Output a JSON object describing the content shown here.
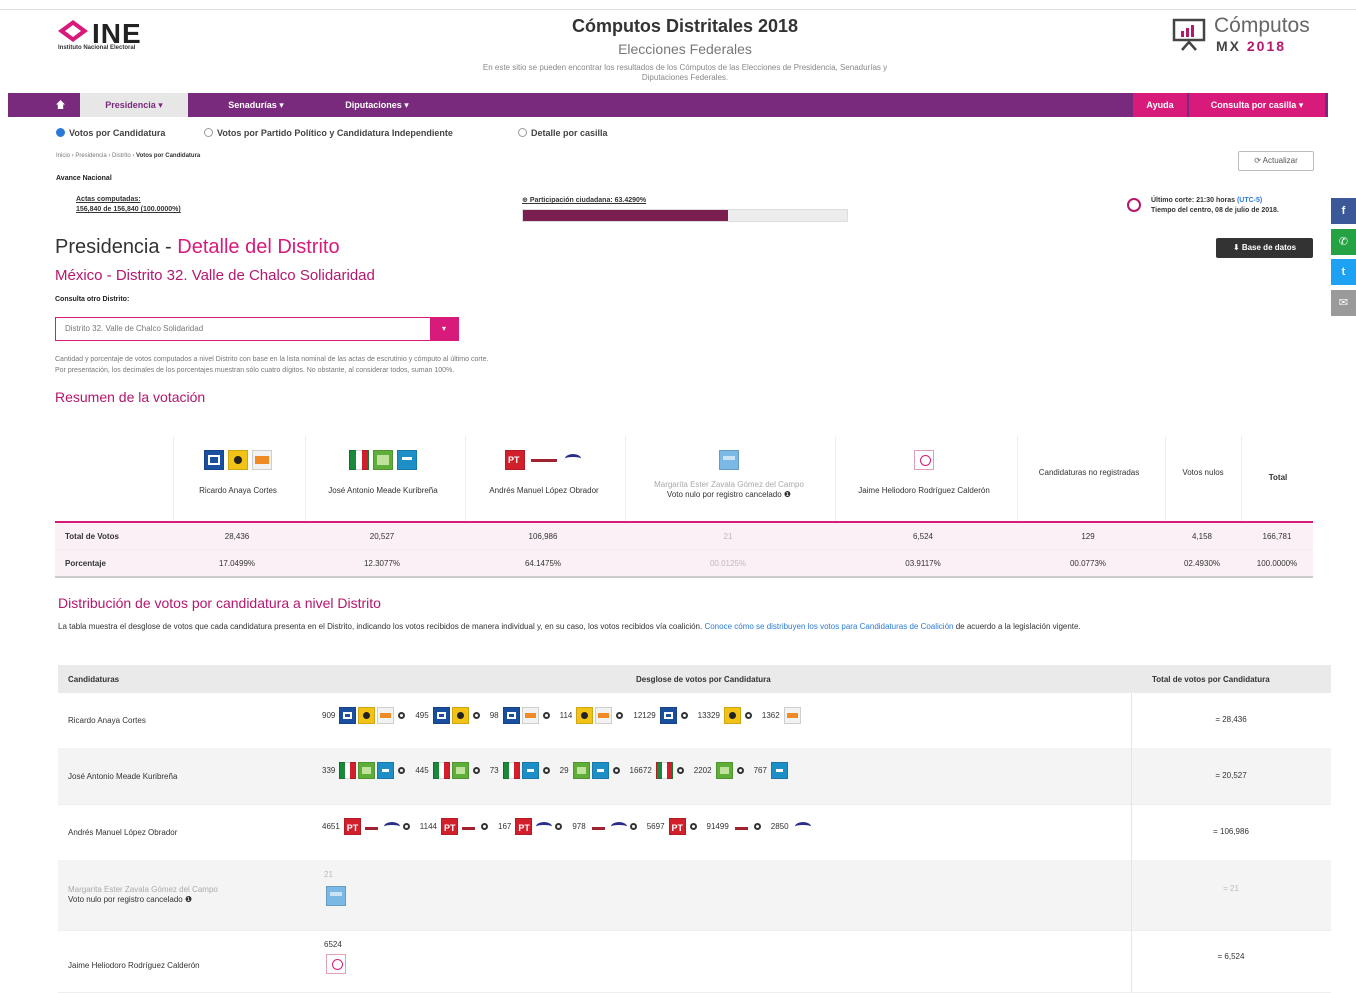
{
  "header": {
    "logo_text": "INE",
    "logo_sub": "Instituto Nacional Electoral",
    "title": "Cómputos Distritales 2018",
    "subtitle": "Elecciones Federales",
    "description_1": "En este sitio se pueden encontrar los resultados de los Cómputos de las Elecciones de Presidencia, Senadurías y",
    "description_2": "Diputaciones Federales.",
    "brand_top": "Cómputos",
    "brand_mx": "MX",
    "brand_year": "2018"
  },
  "nav": {
    "home_icon": "home-icon",
    "presidencia": "Presidencia ▾",
    "senadurias": "Senadurías ▾",
    "diputaciones": "Diputaciones ▾",
    "ayuda": "Ayuda",
    "consulta": "Consulta por casilla ▾"
  },
  "views": {
    "opt1": "Votos por Candidatura",
    "opt2": "Votos por Partido Político y Candidatura Independiente",
    "opt3": "Detalle por casilla"
  },
  "breadcrumb": {
    "path": "Inicio › Presidencia › Distrito › ",
    "current": "Votos por Candidatura"
  },
  "actualizar": "⟳ Actualizar",
  "avance": {
    "label": "Avance Nacional",
    "actas_label": "Actas computadas:",
    "actas_value": "156,840 de 156,840 (100.0000%)",
    "participacion": "Participación ciudadana: 63.4290%",
    "participacion_fraction": 0.634,
    "corte_1": "Último corte: 21:30 horas ",
    "corte_utc": "(UTC-5)",
    "corte_2": "Tiempo del centro, 08 de julio de 2018."
  },
  "social": {
    "fb": "f",
    "wa": "✆",
    "tw": "t",
    "em": "✉"
  },
  "page": {
    "title_a": "Presidencia - ",
    "title_b": "Detalle del Distrito",
    "base_datos": "⬇ Base de datos",
    "distrito": "México - Distrito 32. Valle de Chalco Solidaridad",
    "consulta_label": "Consulta otro Distrito:",
    "select_value": "Distrito 32. Valle de Chalco Solidaridad",
    "note_1": "Cantidad y porcentaje de votos computados a nivel Distrito con base en la lista nominal de las actas de escrutinio y cómputo al último corte.",
    "note_2": "Por presentación, los decimales de los porcentajes muestran sólo cuatro dígitos. No obstante, al considerar todos, suman 100%.",
    "resumen": "Resumen de la votación"
  },
  "summary": {
    "row_total_label": "Total de Votos",
    "row_pct_label": "Porcentaje",
    "columns": [
      {
        "name": "Ricardo Anaya Cortes",
        "total": "28,436",
        "pct": "17.0499%"
      },
      {
        "name": "José Antonio Meade Kuribreña",
        "total": "20,527",
        "pct": "12.3077%"
      },
      {
        "name": "Andrés Manuel López Obrador",
        "total": "106,986",
        "pct": "64.1475%"
      },
      {
        "name": "Margarita Ester Zavala Gómez del Campo",
        "nulo": "Voto nulo por registro cancelado ❶",
        "total": "21",
        "pct": "00.0125%"
      },
      {
        "name": "Jaime Heliodoro Rodríguez Calderón",
        "total": "6,524",
        "pct": "03.9117%"
      },
      {
        "name": "Candidaturas no registradas",
        "total": "129",
        "pct": "00.0773%"
      },
      {
        "name": "Votos nulos",
        "total": "4,158",
        "pct": "02.4930%"
      },
      {
        "name": "Total",
        "total": "166,781",
        "pct": "100.0000%"
      }
    ]
  },
  "distribution": {
    "title": "Distribución de votos por candidatura a nivel Distrito",
    "desc": "La tabla muestra el desglose de votos que cada candidatura presenta en el Distrito, indicando los votos recibidos de manera individual y, en su caso, los votos recibidos vía coalición. ",
    "desc_link": "Conoce cómo se distribuyen los votos para Candidaturas de Coalición",
    "desc_end": " de acuerdo a la legislación vigente.",
    "head_cand": "Candidaturas",
    "head_desglose": "Desglose de votos por Candidatura",
    "head_total": "Total de votos por Candidatura",
    "rows": [
      {
        "cand": "Ricardo Anaya Cortes",
        "total": "= 28,436",
        "groups": [
          {
            "n": "909",
            "p": [
              "pan",
              "prd",
              "mc"
            ]
          },
          {
            "n": "495",
            "p": [
              "pan",
              "prd"
            ]
          },
          {
            "n": "98",
            "p": [
              "pan",
              "mc"
            ]
          },
          {
            "n": "114",
            "p": [
              "prd",
              "mc"
            ]
          },
          {
            "n": "12129",
            "p": [
              "pan"
            ]
          },
          {
            "n": "13329",
            "p": [
              "prd"
            ]
          },
          {
            "n": "1362",
            "p": [
              "mc"
            ],
            "last": true
          }
        ]
      },
      {
        "cand": "José Antonio Meade Kuribreña",
        "total": "= 20,527",
        "groups": [
          {
            "n": "339",
            "p": [
              "pri",
              "pvem",
              "na"
            ]
          },
          {
            "n": "445",
            "p": [
              "pri",
              "pvem"
            ]
          },
          {
            "n": "73",
            "p": [
              "pri",
              "na"
            ]
          },
          {
            "n": "29",
            "p": [
              "pvem",
              "na"
            ]
          },
          {
            "n": "16672",
            "p": [
              "pri"
            ]
          },
          {
            "n": "2202",
            "p": [
              "pvem"
            ]
          },
          {
            "n": "767",
            "p": [
              "na"
            ],
            "last": true
          }
        ]
      },
      {
        "cand": "Andrés Manuel López Obrador",
        "total": "= 106,986",
        "groups": [
          {
            "n": "4651",
            "p": [
              "pt",
              "morena",
              "pes"
            ]
          },
          {
            "n": "1144",
            "p": [
              "pt",
              "morena"
            ]
          },
          {
            "n": "167",
            "p": [
              "pt",
              "pes"
            ]
          },
          {
            "n": "978",
            "p": [
              "morena",
              "pes"
            ]
          },
          {
            "n": "5697",
            "p": [
              "pt"
            ]
          },
          {
            "n": "91499",
            "p": [
              "morena"
            ]
          },
          {
            "n": "2850",
            "p": [
              "pes"
            ],
            "last": true
          }
        ]
      }
    ],
    "row_mz": {
      "cand": "Margarita Ester Zavala Gómez del Campo",
      "nulo": "Voto nulo por registro cancelado ❶",
      "n": "21",
      "total": "= 21"
    },
    "row_jh": {
      "cand": "Jaime Heliodoro Rodríguez Calderón",
      "n": "6524",
      "total": "= 6,524"
    }
  }
}
